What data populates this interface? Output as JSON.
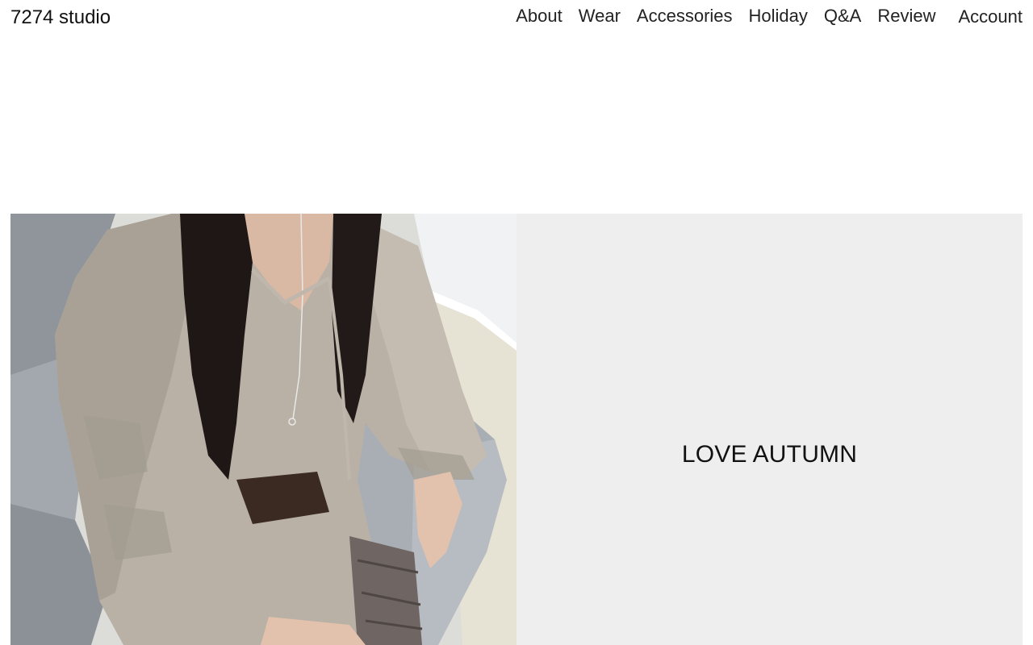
{
  "brand": {
    "name": "7274 studio"
  },
  "nav": {
    "items": [
      {
        "label": "About"
      },
      {
        "label": "Wear"
      },
      {
        "label": "Accessories"
      },
      {
        "label": "Holiday"
      },
      {
        "label": "Q&A"
      },
      {
        "label": "Review"
      }
    ],
    "account_label": "Account"
  },
  "hero": {
    "headline": "LOVE AUTUMN",
    "panel_color": "#eeeeee"
  }
}
